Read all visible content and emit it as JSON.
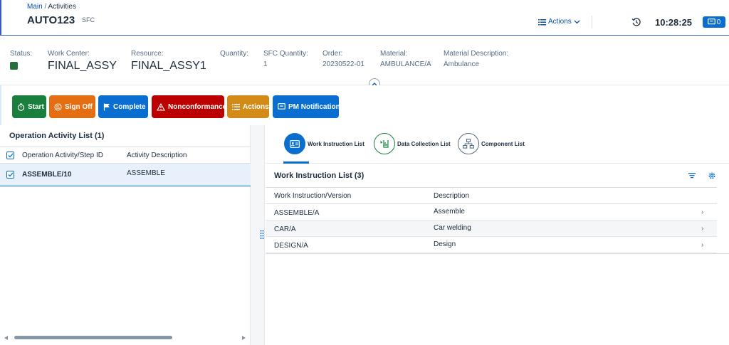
{
  "header": {
    "breadcrumb_main": "Main",
    "breadcrumb_sep": "/",
    "breadcrumb_current": "Activities",
    "title": "AUTO123",
    "subtitle": "SFC",
    "actions_label": "Actions",
    "clock": "10:28:25",
    "notification_count": "0"
  },
  "info": {
    "status_label": "Status:",
    "status_color": "#256f3a",
    "work_center_label": "Work Center:",
    "work_center_value": "FINAL_ASSY",
    "resource_label": "Resource:",
    "resource_value": "FINAL_ASSY1",
    "quantity_label": "Quantity:",
    "sfc_quantity_label": "SFC Quantity:",
    "sfc_quantity_value": "1",
    "order_label": "Order:",
    "order_value": "20230522-01",
    "material_label": "Material:",
    "material_value": "AMBULANCE/A",
    "material_desc_label": "Material Description:",
    "material_desc_value": "Ambulance"
  },
  "toolbar": {
    "buttons": [
      {
        "label": "Start",
        "color": "#1a7f3c"
      },
      {
        "label": "Sign Off",
        "color": "#e56d12"
      },
      {
        "label": "Complete",
        "color": "#0a6ed1"
      },
      {
        "label": "Nonconformance",
        "color": "#bb0000"
      },
      {
        "label": "Actions",
        "color": "#d48a16"
      },
      {
        "label": "PM Notification",
        "color": "#0a6ed1"
      }
    ]
  },
  "left_panel": {
    "title": "Operation Activity List (1)",
    "columns": [
      "Operation Activity/Step ID",
      "Activity Description"
    ],
    "rows": [
      {
        "step_id": "ASSEMBLE/10",
        "description": "ASSEMBLE"
      }
    ]
  },
  "tabs": [
    {
      "label": "Work Instruction List",
      "icon": "id-card-icon"
    },
    {
      "label": "Data Collection List",
      "icon": "data-collection-icon"
    },
    {
      "label": "Component List",
      "icon": "hierarchy-icon"
    }
  ],
  "work_instructions": {
    "title": "Work Instruction List (3)",
    "columns": [
      "Work Instruction/Version",
      "Description"
    ],
    "rows": [
      {
        "version": "ASSEMBLE/A",
        "description": "Assemble"
      },
      {
        "version": "CAR/A",
        "description": "Car welding"
      },
      {
        "version": "DESIGN/A",
        "description": "Design"
      }
    ]
  }
}
